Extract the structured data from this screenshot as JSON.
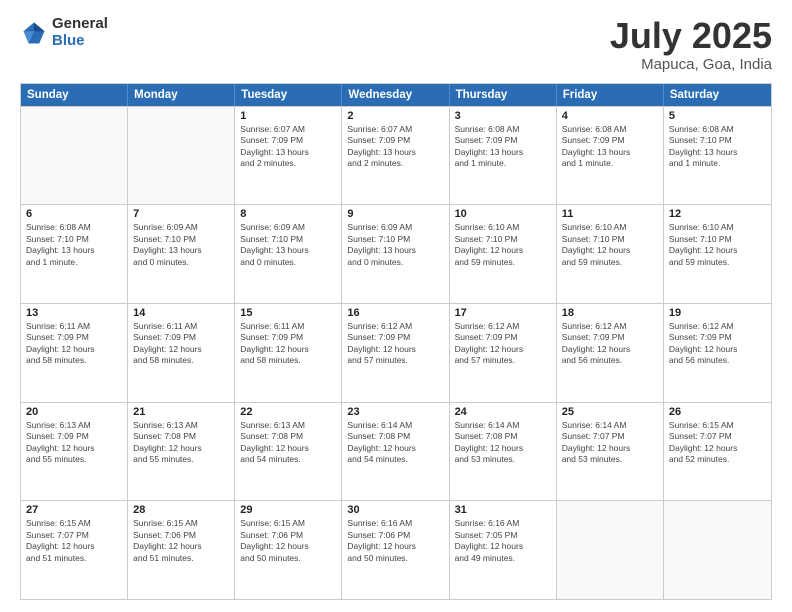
{
  "logo": {
    "general": "General",
    "blue": "Blue"
  },
  "header": {
    "month": "July 2025",
    "location": "Mapuca, Goa, India"
  },
  "weekdays": [
    "Sunday",
    "Monday",
    "Tuesday",
    "Wednesday",
    "Thursday",
    "Friday",
    "Saturday"
  ],
  "weeks": [
    [
      {
        "day": "",
        "detail": ""
      },
      {
        "day": "",
        "detail": ""
      },
      {
        "day": "1",
        "detail": "Sunrise: 6:07 AM\nSunset: 7:09 PM\nDaylight: 13 hours\nand 2 minutes."
      },
      {
        "day": "2",
        "detail": "Sunrise: 6:07 AM\nSunset: 7:09 PM\nDaylight: 13 hours\nand 2 minutes."
      },
      {
        "day": "3",
        "detail": "Sunrise: 6:08 AM\nSunset: 7:09 PM\nDaylight: 13 hours\nand 1 minute."
      },
      {
        "day": "4",
        "detail": "Sunrise: 6:08 AM\nSunset: 7:09 PM\nDaylight: 13 hours\nand 1 minute."
      },
      {
        "day": "5",
        "detail": "Sunrise: 6:08 AM\nSunset: 7:10 PM\nDaylight: 13 hours\nand 1 minute."
      }
    ],
    [
      {
        "day": "6",
        "detail": "Sunrise: 6:08 AM\nSunset: 7:10 PM\nDaylight: 13 hours\nand 1 minute."
      },
      {
        "day": "7",
        "detail": "Sunrise: 6:09 AM\nSunset: 7:10 PM\nDaylight: 13 hours\nand 0 minutes."
      },
      {
        "day": "8",
        "detail": "Sunrise: 6:09 AM\nSunset: 7:10 PM\nDaylight: 13 hours\nand 0 minutes."
      },
      {
        "day": "9",
        "detail": "Sunrise: 6:09 AM\nSunset: 7:10 PM\nDaylight: 13 hours\nand 0 minutes."
      },
      {
        "day": "10",
        "detail": "Sunrise: 6:10 AM\nSunset: 7:10 PM\nDaylight: 12 hours\nand 59 minutes."
      },
      {
        "day": "11",
        "detail": "Sunrise: 6:10 AM\nSunset: 7:10 PM\nDaylight: 12 hours\nand 59 minutes."
      },
      {
        "day": "12",
        "detail": "Sunrise: 6:10 AM\nSunset: 7:10 PM\nDaylight: 12 hours\nand 59 minutes."
      }
    ],
    [
      {
        "day": "13",
        "detail": "Sunrise: 6:11 AM\nSunset: 7:09 PM\nDaylight: 12 hours\nand 58 minutes."
      },
      {
        "day": "14",
        "detail": "Sunrise: 6:11 AM\nSunset: 7:09 PM\nDaylight: 12 hours\nand 58 minutes."
      },
      {
        "day": "15",
        "detail": "Sunrise: 6:11 AM\nSunset: 7:09 PM\nDaylight: 12 hours\nand 58 minutes."
      },
      {
        "day": "16",
        "detail": "Sunrise: 6:12 AM\nSunset: 7:09 PM\nDaylight: 12 hours\nand 57 minutes."
      },
      {
        "day": "17",
        "detail": "Sunrise: 6:12 AM\nSunset: 7:09 PM\nDaylight: 12 hours\nand 57 minutes."
      },
      {
        "day": "18",
        "detail": "Sunrise: 6:12 AM\nSunset: 7:09 PM\nDaylight: 12 hours\nand 56 minutes."
      },
      {
        "day": "19",
        "detail": "Sunrise: 6:12 AM\nSunset: 7:09 PM\nDaylight: 12 hours\nand 56 minutes."
      }
    ],
    [
      {
        "day": "20",
        "detail": "Sunrise: 6:13 AM\nSunset: 7:09 PM\nDaylight: 12 hours\nand 55 minutes."
      },
      {
        "day": "21",
        "detail": "Sunrise: 6:13 AM\nSunset: 7:08 PM\nDaylight: 12 hours\nand 55 minutes."
      },
      {
        "day": "22",
        "detail": "Sunrise: 6:13 AM\nSunset: 7:08 PM\nDaylight: 12 hours\nand 54 minutes."
      },
      {
        "day": "23",
        "detail": "Sunrise: 6:14 AM\nSunset: 7:08 PM\nDaylight: 12 hours\nand 54 minutes."
      },
      {
        "day": "24",
        "detail": "Sunrise: 6:14 AM\nSunset: 7:08 PM\nDaylight: 12 hours\nand 53 minutes."
      },
      {
        "day": "25",
        "detail": "Sunrise: 6:14 AM\nSunset: 7:07 PM\nDaylight: 12 hours\nand 53 minutes."
      },
      {
        "day": "26",
        "detail": "Sunrise: 6:15 AM\nSunset: 7:07 PM\nDaylight: 12 hours\nand 52 minutes."
      }
    ],
    [
      {
        "day": "27",
        "detail": "Sunrise: 6:15 AM\nSunset: 7:07 PM\nDaylight: 12 hours\nand 51 minutes."
      },
      {
        "day": "28",
        "detail": "Sunrise: 6:15 AM\nSunset: 7:06 PM\nDaylight: 12 hours\nand 51 minutes."
      },
      {
        "day": "29",
        "detail": "Sunrise: 6:15 AM\nSunset: 7:06 PM\nDaylight: 12 hours\nand 50 minutes."
      },
      {
        "day": "30",
        "detail": "Sunrise: 6:16 AM\nSunset: 7:06 PM\nDaylight: 12 hours\nand 50 minutes."
      },
      {
        "day": "31",
        "detail": "Sunrise: 6:16 AM\nSunset: 7:05 PM\nDaylight: 12 hours\nand 49 minutes."
      },
      {
        "day": "",
        "detail": ""
      },
      {
        "day": "",
        "detail": ""
      }
    ]
  ]
}
